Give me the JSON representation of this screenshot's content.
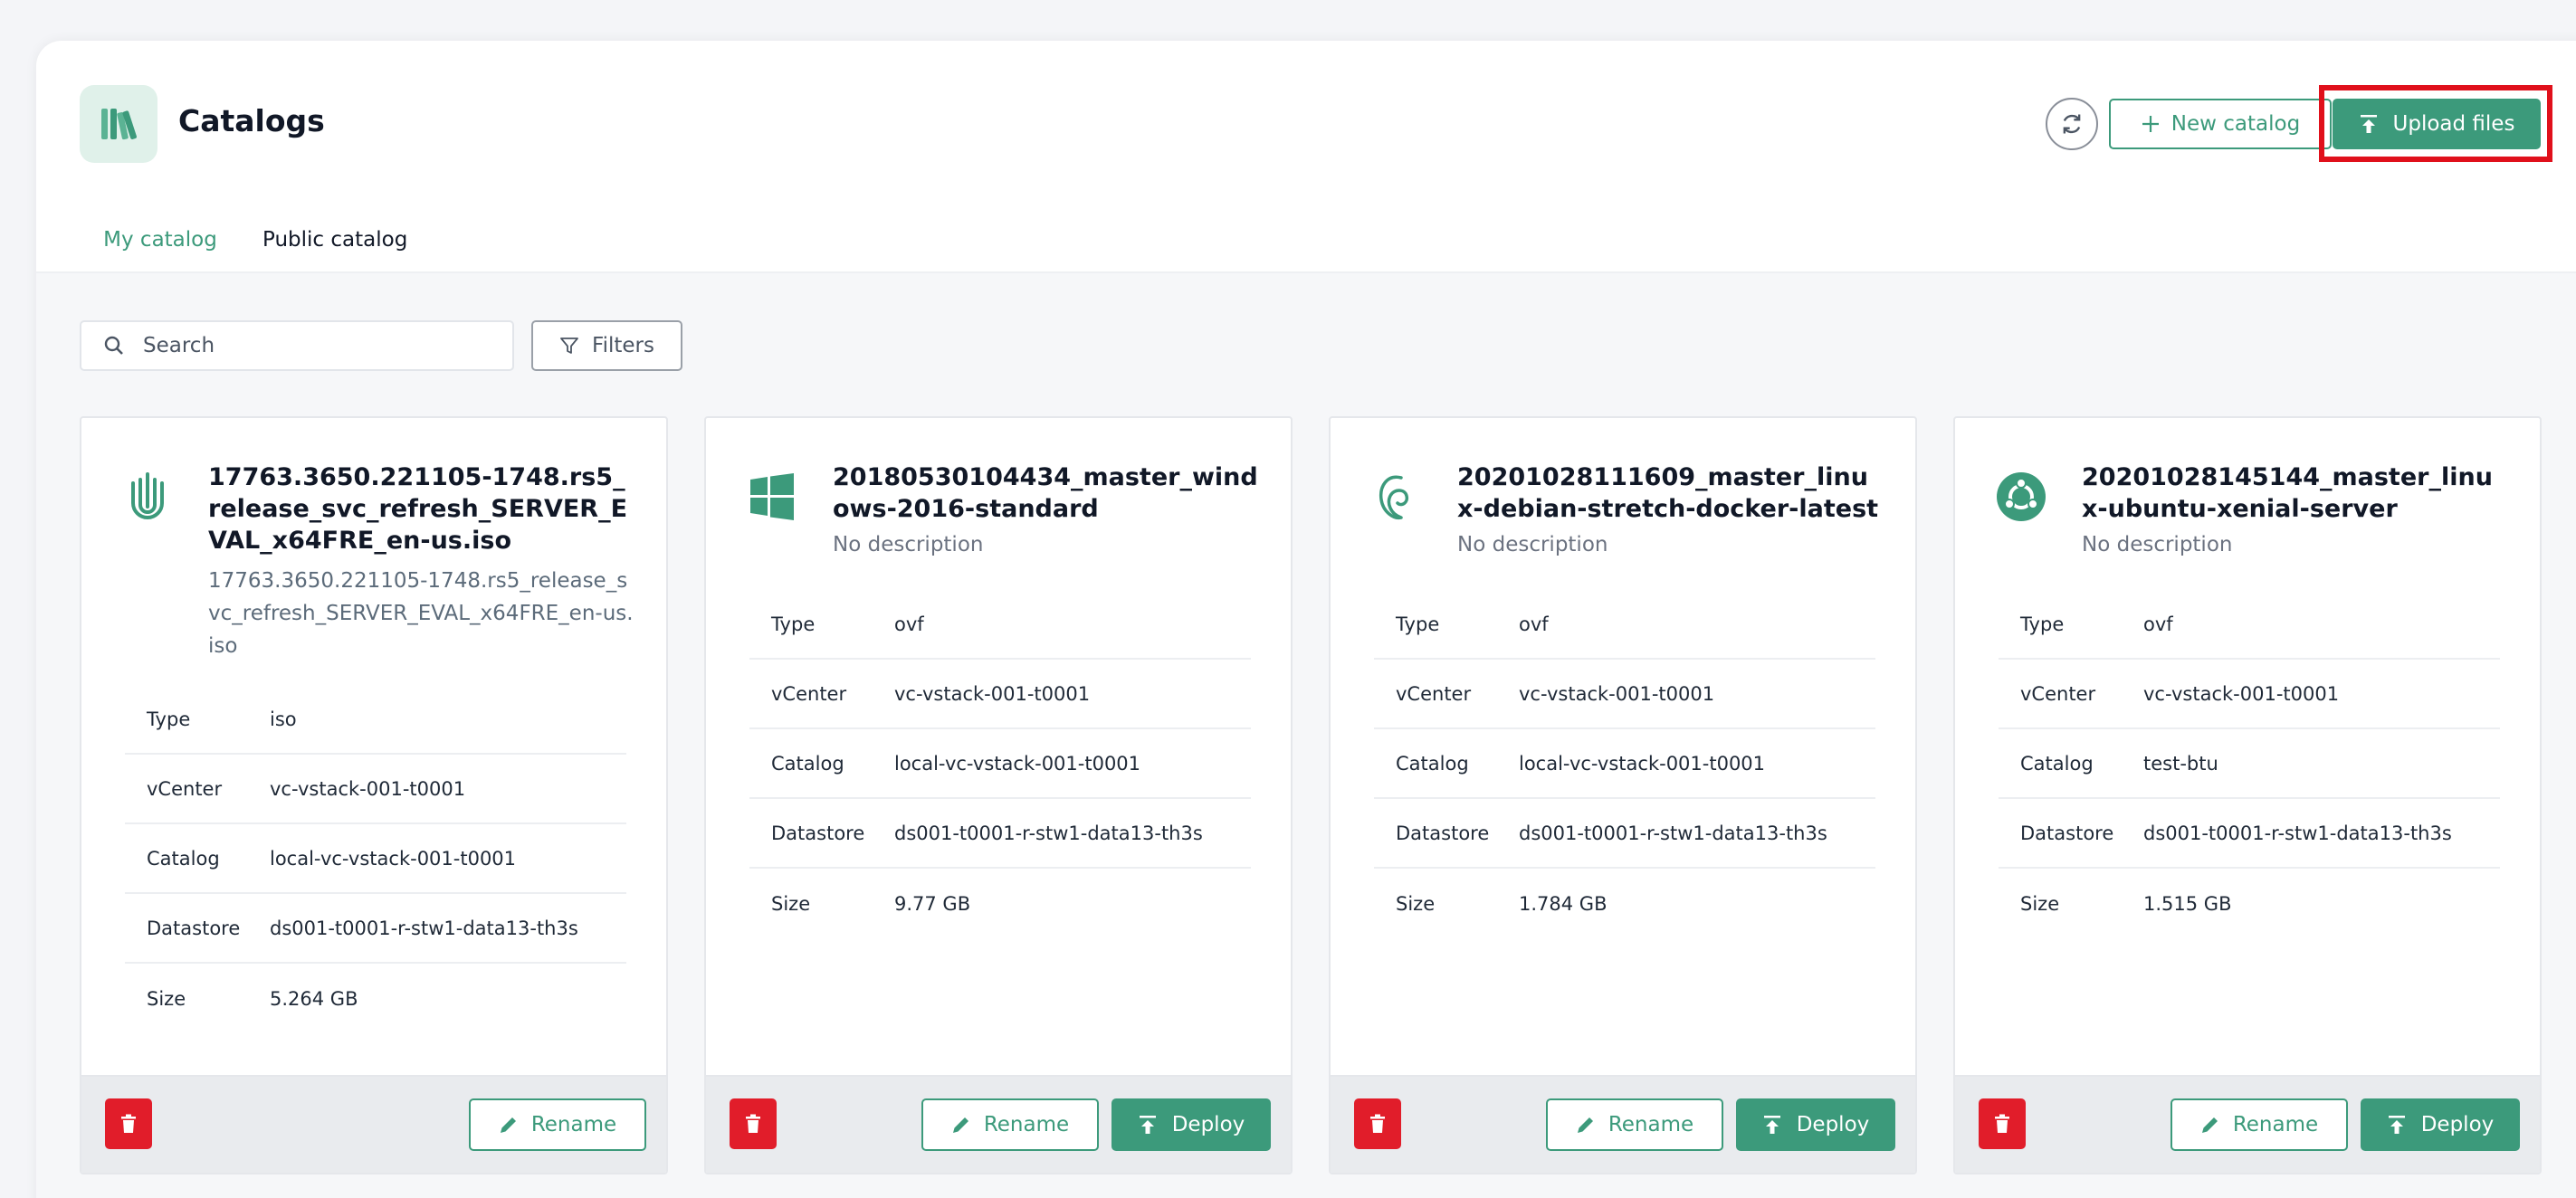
{
  "header": {
    "title": "Catalogs",
    "new_catalog_label": "New catalog",
    "upload_label": "Upload files"
  },
  "tabs": [
    {
      "label": "My catalog",
      "active": true
    },
    {
      "label": "Public catalog",
      "active": false
    }
  ],
  "search": {
    "placeholder": "Search",
    "value": ""
  },
  "filters_label": "Filters",
  "prop_labels": {
    "type": "Type",
    "vcenter": "vCenter",
    "catalog": "Catalog",
    "datastore": "Datastore",
    "size": "Size"
  },
  "actions": {
    "rename": "Rename",
    "deploy": "Deploy"
  },
  "colors": {
    "accent": "#3c9a7b",
    "danger": "#e11d2a",
    "highlight": "#e0101b"
  },
  "cards": [
    {
      "icon": "fingerprint-icon",
      "title": "17763.3650.221105-1748.rs5_release_svc_refresh_SERVER_EVAL_x64FRE_en-us.iso",
      "description": "17763.3650.221105-1748.rs5_release_svc_refresh_SERVER_EVAL_x64FRE_en-us.iso",
      "type": "iso",
      "vcenter": "vc-vstack-001-t0001",
      "catalog": "local-vc-vstack-001-t0001",
      "datastore": "ds001-t0001-r-stw1-data13-th3s",
      "size": "5.264 GB"
    },
    {
      "icon": "windows-icon",
      "title": "20180530104434_master_windows-2016-standard",
      "description": "No description",
      "type": "ovf",
      "vcenter": "vc-vstack-001-t0001",
      "catalog": "local-vc-vstack-001-t0001",
      "datastore": "ds001-t0001-r-stw1-data13-th3s",
      "size": "9.77 GB"
    },
    {
      "icon": "debian-icon",
      "title": "20201028111609_master_linux-debian-stretch-docker-latest",
      "description": "No description",
      "type": "ovf",
      "vcenter": "vc-vstack-001-t0001",
      "catalog": "local-vc-vstack-001-t0001",
      "datastore": "ds001-t0001-r-stw1-data13-th3s",
      "size": "1.784 GB"
    },
    {
      "icon": "ubuntu-icon",
      "title": "20201028145144_master_linux-ubuntu-xenial-server",
      "description": "No description",
      "type": "ovf",
      "vcenter": "vc-vstack-001-t0001",
      "catalog": "test-btu",
      "datastore": "ds001-t0001-r-stw1-data13-th3s",
      "size": "1.515 GB"
    }
  ]
}
